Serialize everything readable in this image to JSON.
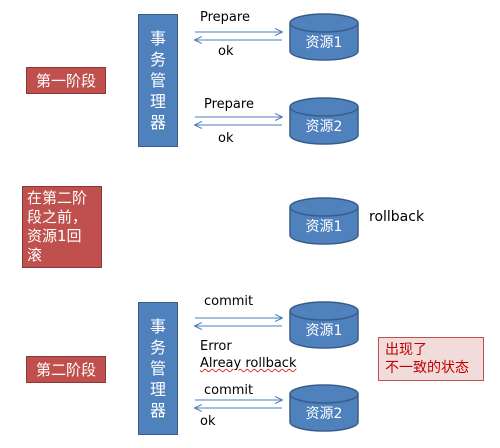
{
  "phase1": {
    "stage_label": "第一阶段",
    "manager_chars": [
      "事",
      "务",
      "管",
      "理",
      "器"
    ],
    "exchanges": [
      {
        "request": "Prepare",
        "response": "ok",
        "resource": "资源1"
      },
      {
        "request": "Prepare",
        "response": "ok",
        "resource": "资源2"
      }
    ]
  },
  "middle": {
    "note": "在第二阶段之前，资源1回滚",
    "note_lines": [
      "在第二阶",
      "段之前，",
      "资源1回",
      "滚"
    ],
    "resource": "资源1",
    "action": "rollback"
  },
  "phase2": {
    "stage_label": "第二阶段",
    "manager_chars": [
      "事",
      "务",
      "管",
      "理",
      "器"
    ],
    "exchanges": [
      {
        "request": "commit",
        "response_lines": [
          "Error",
          "Alreay rollback"
        ],
        "resource": "资源1"
      },
      {
        "request": "commit",
        "response": "ok",
        "resource": "资源2"
      }
    ],
    "warning_lines": [
      "出现了",
      "不一致的状态"
    ]
  },
  "colors": {
    "stage_fill": "#c0504d",
    "manager_fill": "#4f81bd",
    "db_fill": "#4f81bd",
    "db_stroke": "#385d8a",
    "arrow": "#4a7ebb",
    "warning_fill": "#f2dcdb",
    "warning_text": "#c00000"
  }
}
